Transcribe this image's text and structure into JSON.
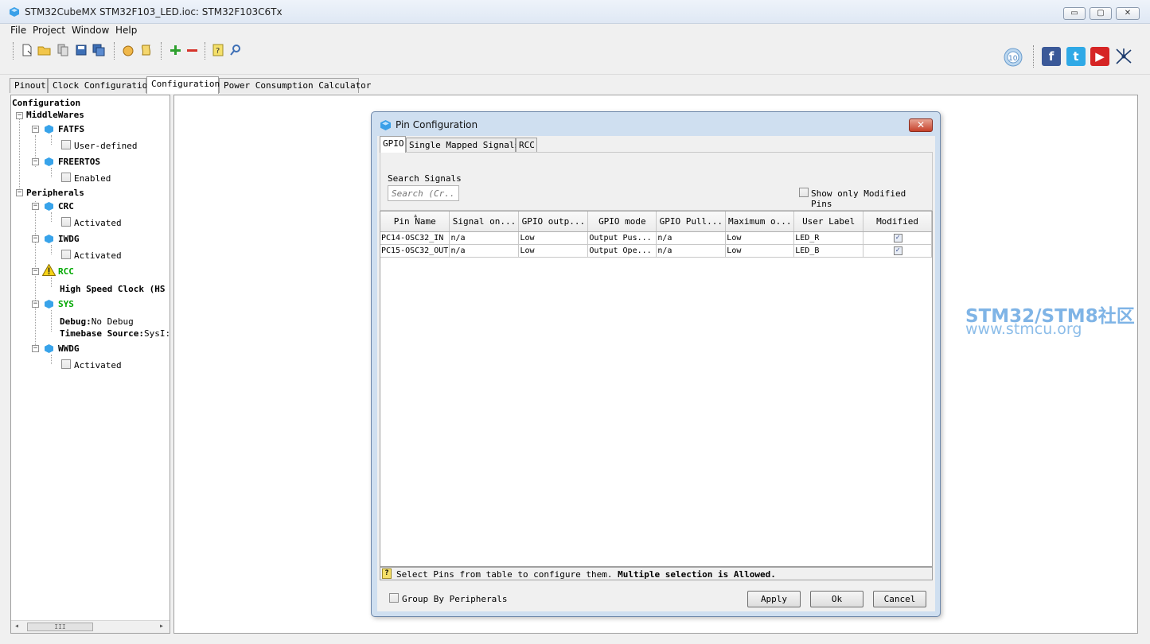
{
  "window": {
    "title": "STM32CubeMX STM32F103_LED.ioc: STM32F103C6Tx",
    "minimize": "▭",
    "maximize": "▢",
    "close": "✕"
  },
  "menu": [
    "File",
    "Project",
    "Window",
    "Help"
  ],
  "toolbar": {
    "icons": [
      "new-file-icon",
      "open-folder-icon",
      "copy-icon",
      "save-icon",
      "save-all-icon",
      "hand-icon",
      "script-icon",
      "zoom-in-icon",
      "zoom-out-icon",
      "help-icon",
      "search-about-icon"
    ],
    "social": [
      "badge-icon",
      "facebook-icon",
      "twitter-icon",
      "youtube-icon",
      "network-icon"
    ]
  },
  "main_tabs": [
    "Pinout",
    "Clock Configuration",
    "Configuration",
    "Power Consumption Calculator"
  ],
  "main_tabs_active": "Configuration",
  "tree": {
    "root": "Configuration",
    "middlewares": "MiddleWares",
    "fatfs": "FATFS",
    "fatfs_opt": "User-defined",
    "freertos": "FREERTOS",
    "freertos_opt": "Enabled",
    "peripherals": "Peripherals",
    "crc": "CRC",
    "crc_opt": "Activated",
    "iwdg": "IWDG",
    "iwdg_opt": "Activated",
    "rcc": "RCC",
    "rcc_hse": "High Speed Clock (HS",
    "sys": "SYS",
    "sys_debug_key": "Debug:",
    "sys_debug_val": "No Debug",
    "sys_tb_key": "Timebase Source:",
    "sys_tb_val": "SysI:",
    "wwdg": "WWDG",
    "wwdg_opt": "Activated",
    "scroll_grip": "III"
  },
  "watermark": {
    "line1": "STM32/STM8社区",
    "line2": "www.stmcu.org"
  },
  "dialog": {
    "title": "Pin Configuration",
    "tabs": [
      "GPIO",
      "Single Mapped Signals",
      "RCC"
    ],
    "search_label": "Search Signals",
    "search_placeholder": "Search (Cr...",
    "show_modified": "Show only Modified Pins",
    "columns": [
      "Pin Name",
      "Signal on...",
      "GPIO outp...",
      "GPIO mode",
      "GPIO Pull...",
      "Maximum o...",
      "User Label",
      "Modified"
    ],
    "rows": [
      [
        "PC14-OSC32_IN",
        "n/a",
        "Low",
        "Output Pus...",
        "n/a",
        "Low",
        "LED_R",
        "✓"
      ],
      [
        "PC15-OSC32_OUT",
        "n/a",
        "Low",
        "Output Ope...",
        "n/a",
        "Low",
        "LED_B",
        "✓"
      ]
    ],
    "hint_icon": "?",
    "hint_plain": "Select Pins from table to configure them. ",
    "hint_bold": "Multiple selection is Allowed.",
    "group_label": "Group By Peripherals",
    "apply": "Apply",
    "ok": "Ok",
    "cancel": "Cancel",
    "close": "✕"
  },
  "colors": {
    "green_label": "#00a800",
    "accent": "#3a8fd6"
  }
}
